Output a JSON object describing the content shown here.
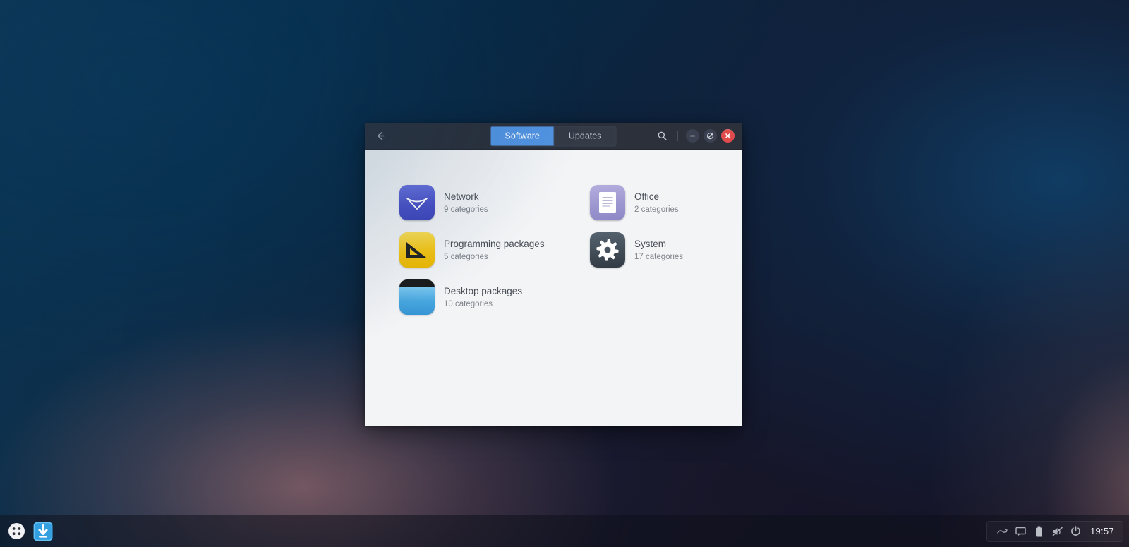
{
  "desktop": {
    "wallpaper_colors": [
      "#06304f",
      "#14192f",
      "#141225",
      "#96696e"
    ]
  },
  "window": {
    "titlebar": {
      "back_label": "←",
      "back_icon": "arrow-left-icon",
      "search_icon": "search-icon",
      "tabs": [
        {
          "label": "Software",
          "active": true
        },
        {
          "label": "Updates",
          "active": false
        }
      ],
      "controls": [
        {
          "name": "minimize",
          "glyph": "−",
          "color": "#3b4150"
        },
        {
          "name": "maximize",
          "glyph": "○",
          "color": "#3b4150"
        },
        {
          "name": "close",
          "glyph": "✕",
          "color": "#e04b4b"
        }
      ]
    },
    "accent_color": "#5294e2",
    "body_color": "#f3f4f6",
    "categories": [
      {
        "title": "Network",
        "subtitle": "9 categories",
        "icon": "wifi-icon",
        "icon_class": "icon-network"
      },
      {
        "title": "Office",
        "subtitle": "2 categories",
        "icon": "document-icon",
        "icon_class": "icon-office"
      },
      {
        "title": "Programming packages",
        "subtitle": "5 categories",
        "icon": "set-square-icon",
        "icon_class": "icon-programming"
      },
      {
        "title": "System",
        "subtitle": "17 categories",
        "icon": "gear-icon",
        "icon_class": "icon-system"
      },
      {
        "title": "Desktop packages",
        "subtitle": "10 categories",
        "icon": "window-icon",
        "icon_class": "icon-desktop"
      }
    ]
  },
  "taskbar": {
    "launchers": [
      {
        "name": "app-menu",
        "icon": "grid-dots-icon"
      },
      {
        "name": "software-manager",
        "icon": "download-arrow-icon",
        "active": true
      }
    ],
    "tray": [
      {
        "name": "network-icon"
      },
      {
        "name": "chat-icon"
      },
      {
        "name": "battery-icon"
      },
      {
        "name": "volume-muted-icon"
      },
      {
        "name": "power-icon"
      }
    ],
    "clock": "19:57"
  }
}
